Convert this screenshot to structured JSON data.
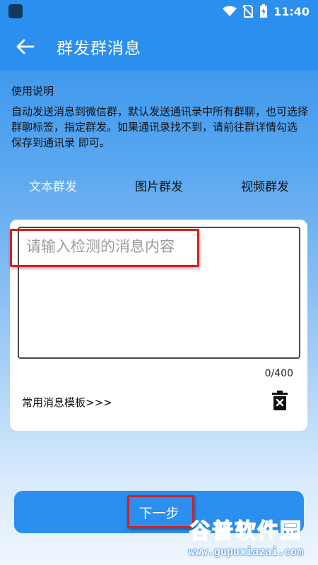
{
  "status_bar": {
    "time": "11:40"
  },
  "app_bar": {
    "title": "群发群消息"
  },
  "instructions": {
    "title": "使用说明",
    "body": "自动发送消息到微信群，默认发送通讯录中所有群聊，也可选择群聊标签，指定群发。如果通讯录找不到，请前往群详情勾选 保存到通讯录 即可。"
  },
  "tabs": [
    {
      "label": "文本群发",
      "active": true
    },
    {
      "label": "图片群发",
      "active": false
    },
    {
      "label": "视频群发",
      "active": false
    }
  ],
  "message_input": {
    "placeholder": "请输入检测的消息内容",
    "value": ""
  },
  "counter": "0/400",
  "template_link": "常用消息模板>>>",
  "next_button": {
    "label": "下一步"
  },
  "watermark": {
    "main": "谷普软件园",
    "sub": "www.gupuxiazai.com"
  },
  "colors": {
    "primary": "#2b8ff0",
    "highlight": "#d81e1e"
  }
}
